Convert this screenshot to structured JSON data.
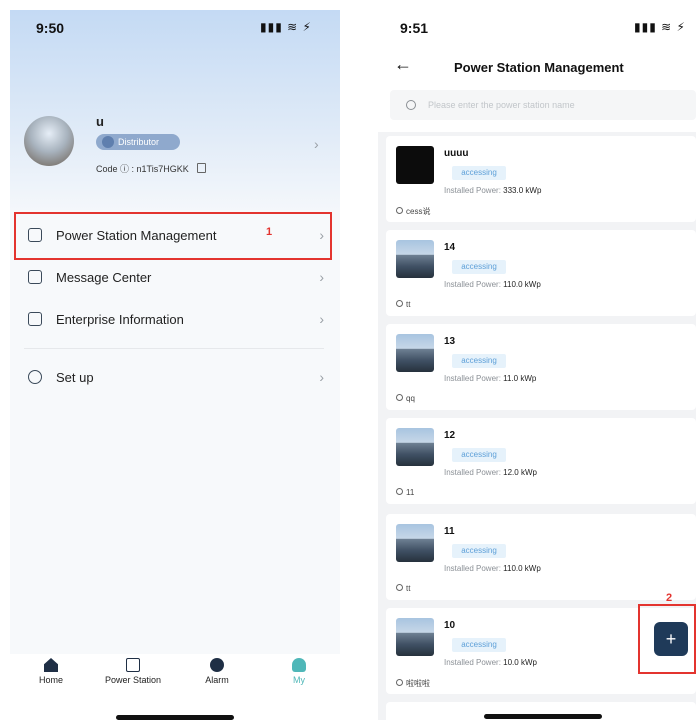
{
  "left": {
    "status_time": "9:50",
    "status_icons": "▮▮▮ ≋ ⚡",
    "user_name": "u",
    "role_badge": "Distributor",
    "code_label": "Code ⓘ : n1Tis7HGKK",
    "menu": [
      {
        "label": "Power Station Management",
        "annot": "1"
      },
      {
        "label": "Message Center"
      },
      {
        "label": "Enterprise Information"
      },
      {
        "label": "Set up"
      }
    ],
    "tabs": [
      {
        "label": "Home",
        "icon": "home-icon"
      },
      {
        "label": "Power Station",
        "icon": "building-icon"
      },
      {
        "label": "Alarm",
        "icon": "alarm-icon"
      },
      {
        "label": "My",
        "icon": "person-icon"
      }
    ]
  },
  "right": {
    "status_time": "9:51",
    "status_icons": "▮▮▮ ≋ ⚡",
    "title": "Power Station Management",
    "search_placeholder": "Please enter the power station name",
    "stations": [
      {
        "name": "uuuu",
        "status": "accessing",
        "power_label": "Installed Power:",
        "power": "333.0 kWp",
        "owner": "cess说"
      },
      {
        "name": "14",
        "status": "accessing",
        "power_label": "Installed Power:",
        "power": "110.0 kWp",
        "owner": "tt"
      },
      {
        "name": "13",
        "status": "accessing",
        "power_label": "Installed Power:",
        "power": "11.0 kWp",
        "owner": "qq"
      },
      {
        "name": "12",
        "status": "accessing",
        "power_label": "Installed Power:",
        "power": "12.0 kWp",
        "owner": "11"
      },
      {
        "name": "11",
        "status": "accessing",
        "power_label": "Installed Power:",
        "power": "110.0 kWp",
        "owner": "tt"
      },
      {
        "name": "10",
        "status": "accessing",
        "power_label": "Installed Power:",
        "power": "10.0 kWp",
        "owner": "啦啦啦"
      }
    ],
    "fab_label": "+",
    "fab_annot": "2"
  },
  "colors": {
    "accent": "#4fb7b8",
    "annotation_red": "#e3342f",
    "fab_bg": "#1f3a59",
    "badge_blue": "#5ea0d8"
  }
}
